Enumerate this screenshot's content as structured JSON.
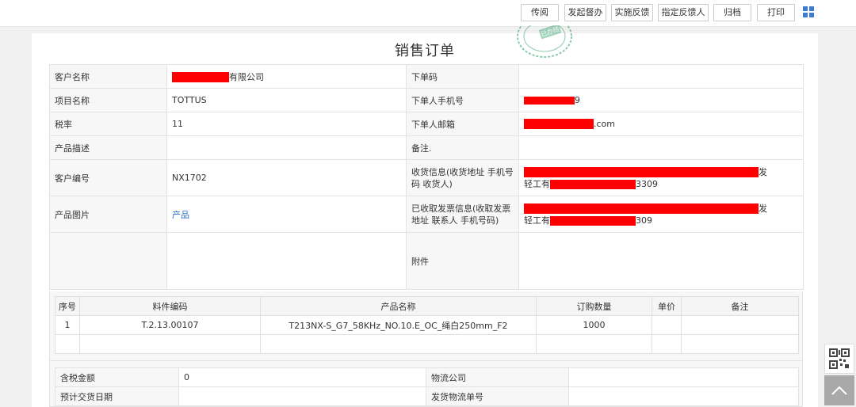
{
  "toolbar": {
    "buttons": [
      "传阅",
      "发起督办",
      "实施反馈",
      "指定反馈人",
      "归档",
      "打印"
    ]
  },
  "stamp_text": "已办结",
  "title": "销售订单",
  "info": {
    "customer_name_label": "客户名称",
    "customer_name_suffix": "有限公司",
    "order_code_label": "下单码",
    "order_code_value": "",
    "project_name_label": "项目名称",
    "project_name_value": "TOTTUS",
    "orderer_phone_label": "下单人手机号",
    "orderer_phone_suffix": "9",
    "tax_rate_label": "税率",
    "tax_rate_value": "11",
    "orderer_email_label": "下单人邮箱",
    "orderer_email_suffix": ".com",
    "product_desc_label": "产品描述",
    "product_desc_value": "",
    "remark_label": "备注.",
    "remark_value": "",
    "customer_no_label": "客户编号",
    "customer_no_value": "NX1702",
    "shipping_info_label": "收货信息(收货地址 手机号码 收货人)",
    "shipping_info_line1_suffix": "发",
    "shipping_info_line2_prefix": "轻工有",
    "shipping_info_line2_suffix": "3309",
    "product_image_label": "产品图片",
    "product_image_link": "产品",
    "invoice_info_label": "已收取发票信息(收取发票地址 联系人 手机号码)",
    "invoice_info_line1_suffix": "发",
    "invoice_info_line2_prefix": "轻工有",
    "invoice_info_line2_suffix": "309",
    "attachment_label": "附件"
  },
  "items": {
    "headers": [
      "序号",
      "料件编码",
      "产品名称",
      "订购数量",
      "单价",
      "备注"
    ],
    "rows": [
      [
        "1",
        "T.2.13.00107",
        "T213NX-S_G7_58KHz_NO.10.E_OC_绳白250mm_F2",
        "1000",
        "",
        ""
      ],
      [
        "",
        "",
        "",
        "",
        "",
        ""
      ]
    ]
  },
  "money": {
    "tax_amount_label": "含税金额",
    "tax_amount_value": "0",
    "logistics_company_label": "物流公司",
    "logistics_company_value": "",
    "delivery_date_label": "预计交货日期",
    "delivery_date_value": "",
    "tracking_no_label": "发货物流单号",
    "tracking_no_value": ""
  },
  "colors": {
    "redaction": "#ff0000",
    "link": "#2a6ecc",
    "accent": "#3d7cd6"
  },
  "icons": {
    "grid": "grid-icon",
    "qr": "qr-code-icon",
    "back_to_top": "chevron-up-icon"
  }
}
